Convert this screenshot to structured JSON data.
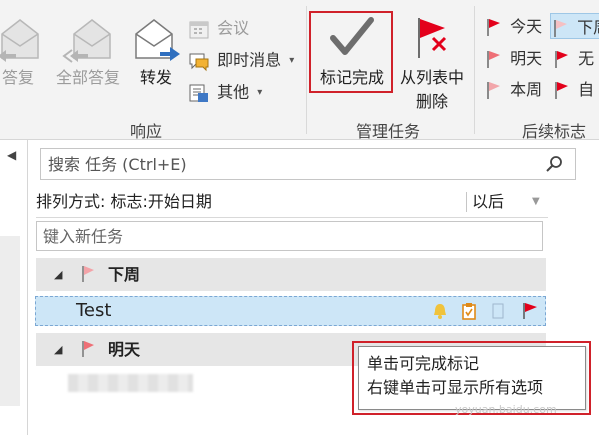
{
  "ribbon": {
    "respond": {
      "group_label": "响应",
      "reply_label": "答复",
      "reply_all_label": "全部答复",
      "forward_label": "转发",
      "meeting_label": "会议",
      "im_label": "即时消息",
      "more_label": "其他"
    },
    "manage": {
      "group_label": "管理任务",
      "mark_complete_label": "标记完成",
      "remove_label_line1": "从列表中",
      "remove_label_line2": "删除"
    },
    "followup": {
      "group_label": "后续标志",
      "today": "今天",
      "tomorrow": "明天",
      "this_week": "本周",
      "next_week": "下周",
      "no_date": "无",
      "custom": "自"
    }
  },
  "colors": {
    "highlight_red": "#d0212a",
    "selection_blue": "#cde6f7",
    "flag_red": "#e3001b"
  },
  "task_pane": {
    "search": {
      "placeholder": "搜索 任务 (Ctrl+E)"
    },
    "sort": {
      "label": "排列方式: 标志:开始日期",
      "order": "以后"
    },
    "new_task": {
      "placeholder": "键入新任务"
    },
    "groups": [
      {
        "name": "下周",
        "tasks": [
          {
            "title": "Test"
          }
        ]
      },
      {
        "name": "明天",
        "tasks": []
      }
    ]
  },
  "tooltip": {
    "line1": "单击可完成标记",
    "line2": "右键单击可显示所有选项"
  },
  "watermark": "yoyuan.baidu.com"
}
